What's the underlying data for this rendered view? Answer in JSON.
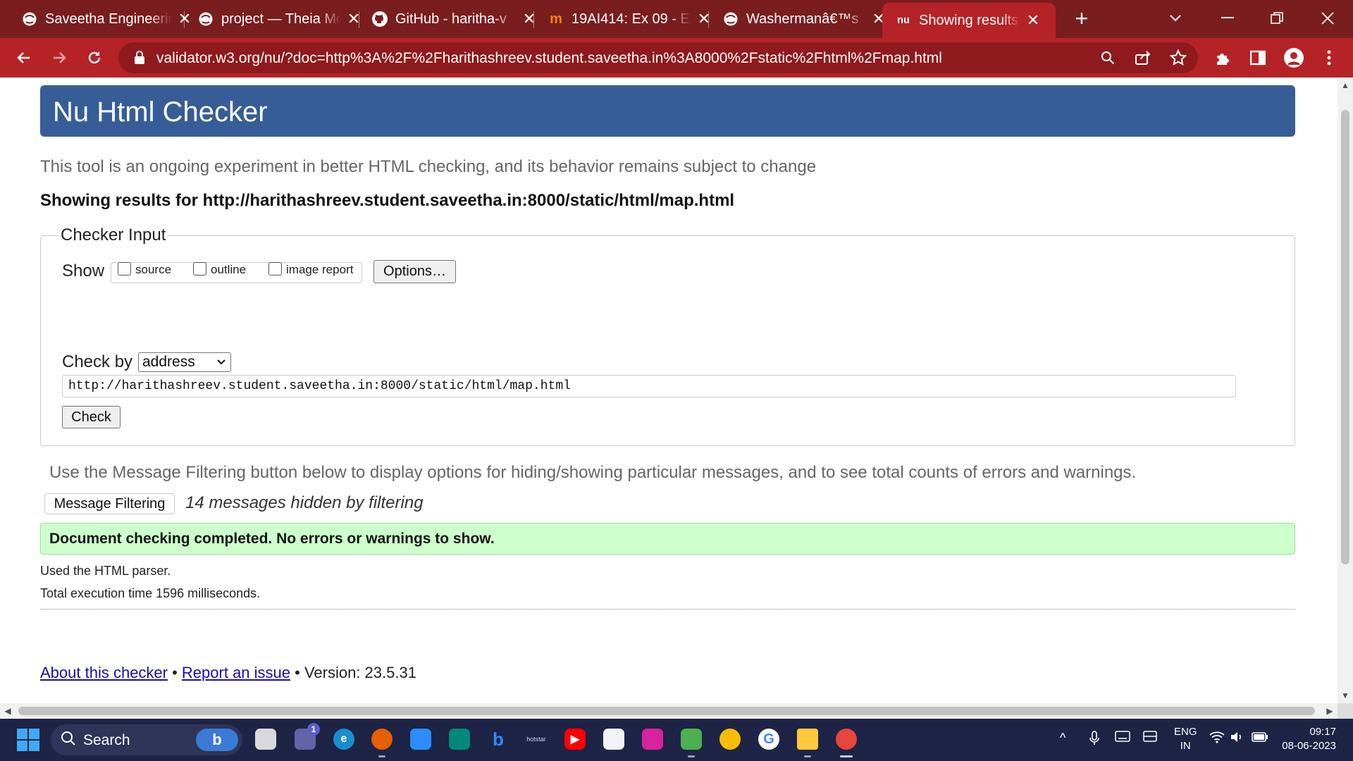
{
  "browser": {
    "tabs": [
      {
        "label": "Saveetha Engineering College",
        "icon": "globe-icon"
      },
      {
        "label": "project — Theia Mongo",
        "icon": "globe-icon"
      },
      {
        "label": "GitHub - haritha-v",
        "icon": "github-icon"
      },
      {
        "label": "19AI414: Ex 09 - E",
        "icon": "moodle-icon"
      },
      {
        "label": "Washermanâ€™s",
        "icon": "globe-icon"
      },
      {
        "label": "Showing results for",
        "icon": "nu-icon",
        "active": true
      }
    ],
    "tab_close_glyph": "✕",
    "new_tab_glyph": "+",
    "url": "validator.w3.org/nu/?doc=http%3A%2F%2Fharithashreev.student.saveetha.in%3A8000%2Fstatic%2Fhtml%2Fmap.html",
    "theme_colors": {
      "tabstrip": "#7a1d1f",
      "toolbar": "#b62327"
    }
  },
  "page": {
    "title": "Nu Html Checker",
    "intro": "This tool is an ongoing experiment in better HTML checking, and its behavior remains subject to change",
    "showing_results": "Showing results for http://harithashreev.student.saveetha.in:8000/static/html/map.html",
    "checker_input": {
      "legend": "Checker Input",
      "show_label": "Show",
      "checkboxes": [
        "source",
        "outline",
        "image report"
      ],
      "options_button": "Options…",
      "check_by_label": "Check by",
      "check_by_value": "address",
      "url_value": "http://harithashreev.student.saveetha.in:8000/static/html/map.html",
      "check_button": "Check"
    },
    "filter_info": "Use the Message Filtering button below to display options for hiding/showing particular messages, and to see total counts of errors and warnings.",
    "filter_button": "Message Filtering",
    "hidden_messages": "14 messages hidden by filtering",
    "success": "Document checking completed. No errors or warnings to show.",
    "parser_note": "Used the HTML parser.",
    "exec_time": "Total execution time 1596 milliseconds.",
    "footer": {
      "about_link": "About this checker",
      "separator": " • ",
      "report_link": "Report an issue",
      "version": " • Version: 23.5.31"
    },
    "colors": {
      "header": "#365d95",
      "success_bg": "#ccffcc",
      "link": "#1a0dab"
    }
  },
  "taskbar": {
    "search_placeholder": "Search",
    "bing_badge": "b",
    "teams_badge": "1",
    "language_top": "ENG",
    "language_bottom": "IN",
    "time": "09:17",
    "date": "08-06-2023"
  }
}
